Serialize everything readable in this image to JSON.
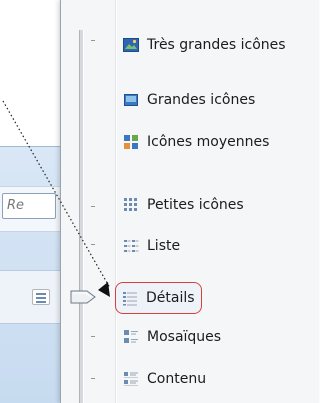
{
  "background": {
    "search_placeholder": "Re"
  },
  "view_menu": {
    "items": [
      {
        "label": "Très grandes icônes",
        "icon": "extra-large-icons-icon",
        "selected": false
      },
      {
        "label": "Grandes icônes",
        "icon": "large-icons-icon",
        "selected": false
      },
      {
        "label": "Icônes moyennes",
        "icon": "medium-icons-icon",
        "selected": false
      },
      {
        "label": "Petites icônes",
        "icon": "small-icons-icon",
        "selected": false
      },
      {
        "label": "Liste",
        "icon": "list-icon",
        "selected": false
      },
      {
        "label": "Détails",
        "icon": "details-icon",
        "selected": true
      },
      {
        "label": "Mosaïques",
        "icon": "tiles-icon",
        "selected": false
      },
      {
        "label": "Contenu",
        "icon": "content-icon",
        "selected": false
      }
    ]
  },
  "colors": {
    "highlight_border": "#d8403f",
    "menu_background": "#f5f6f7",
    "accent_blue": "#3a78c4"
  }
}
